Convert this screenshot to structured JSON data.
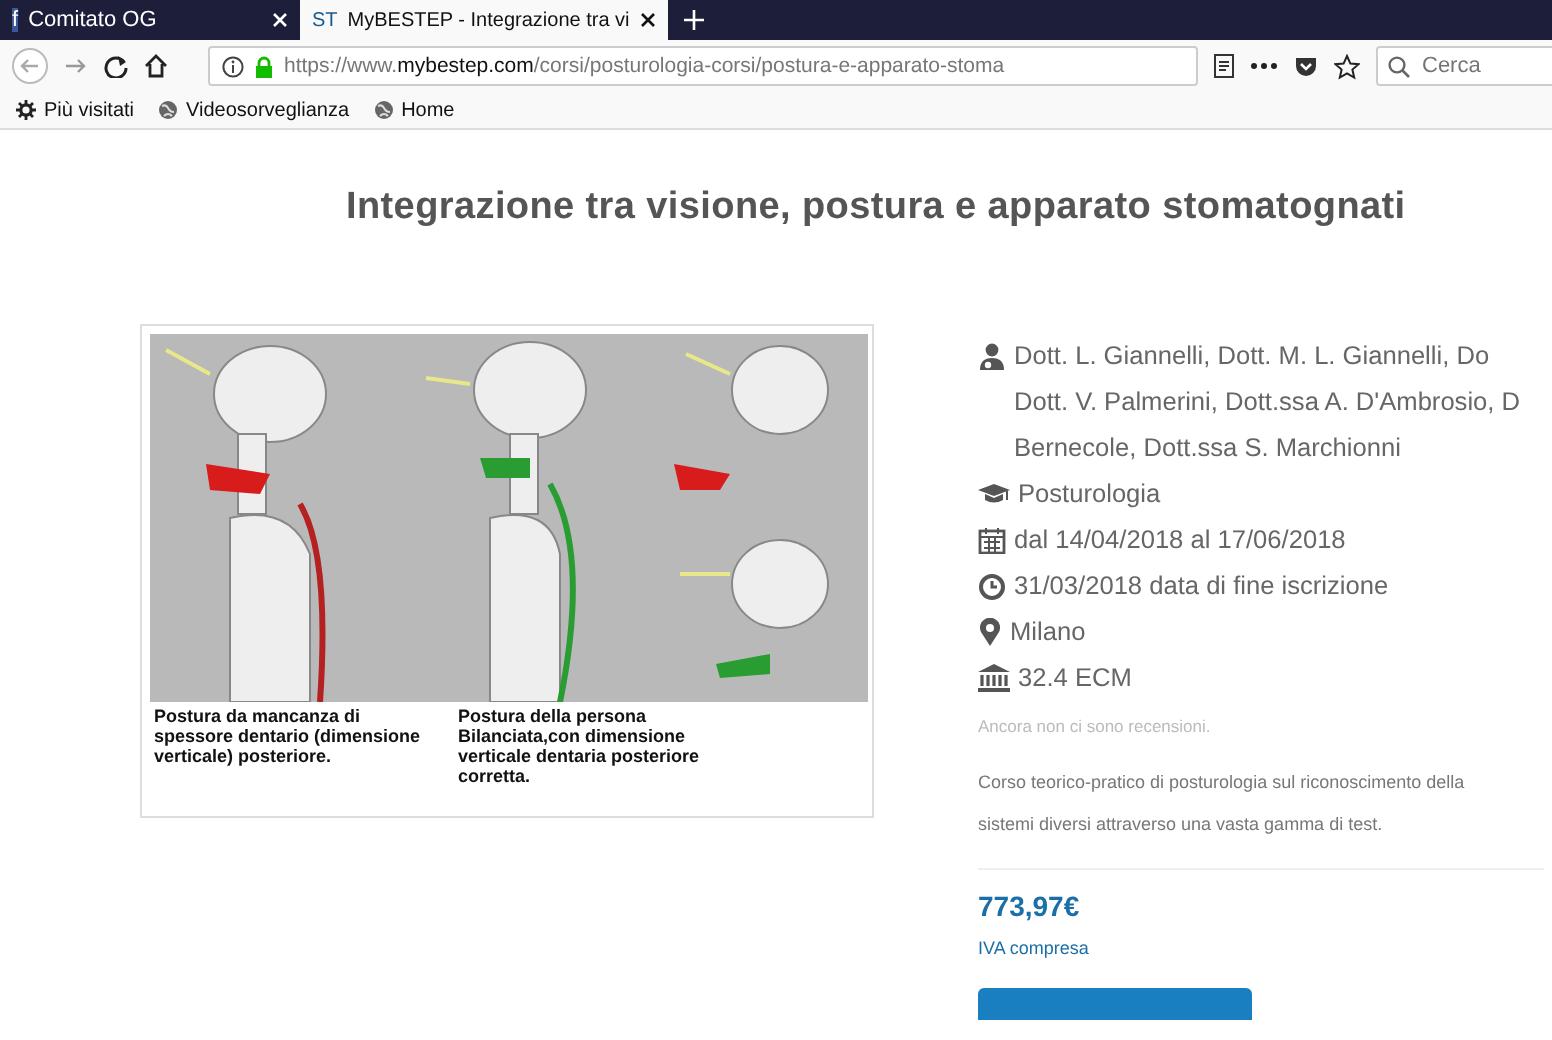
{
  "browser": {
    "tabs": [
      {
        "favicon": "f",
        "kind": "facebook",
        "title": "Comitato OG",
        "selected": false
      },
      {
        "favicon": "ST",
        "kind": "site",
        "title": "MyBESTEP - Integrazione tra vi",
        "selected": true
      }
    ],
    "url": {
      "scheme": "https://www.",
      "domain": "mybestep.com",
      "path": "/corsi/posturologia-corsi/postura-e-apparato-stoma"
    },
    "search": {
      "placeholder": "Cerca"
    },
    "bookmarks": [
      {
        "kind": "special",
        "label": "Più visitati"
      },
      {
        "kind": "site",
        "label": "Videosorveglianza"
      },
      {
        "kind": "site",
        "label": "Home"
      }
    ]
  },
  "page": {
    "title": "Integrazione tra visione, postura e apparato stomatognati",
    "figure": {
      "captions": [
        "Postura da mancanza di spessore dentario (dimensione verticale) posteriore.",
        "Postura della persona Bilanciata,con dimensione verticale dentaria posteriore corretta."
      ]
    },
    "details": [
      {
        "kind": "teachers",
        "lines": [
          "Dott. L. Giannelli, Dott. M. L. Giannelli, Do",
          "Dott. V. Palmerini, Dott.ssa A. D'Ambrosio, D",
          "Bernecole, Dott.ssa S. Marchionni"
        ]
      },
      {
        "kind": "category",
        "lines": [
          "Posturologia"
        ]
      },
      {
        "kind": "dates",
        "lines": [
          "dal 14/04/2018 al 17/06/2018"
        ]
      },
      {
        "kind": "deadline",
        "lines": [
          "31/03/2018 data di fine iscrizione"
        ]
      },
      {
        "kind": "location",
        "lines": [
          "Milano"
        ]
      },
      {
        "kind": "credits",
        "lines": [
          "32.4 ECM"
        ]
      }
    ],
    "reviews_note": "Ancora non ci sono recensioni.",
    "description": [
      "Corso teorico-pratico di posturologia sul riconoscimento della",
      "sistemi diversi attraverso una vasta gamma di test."
    ],
    "price": "773,97€",
    "price_note": "IVA compresa"
  }
}
